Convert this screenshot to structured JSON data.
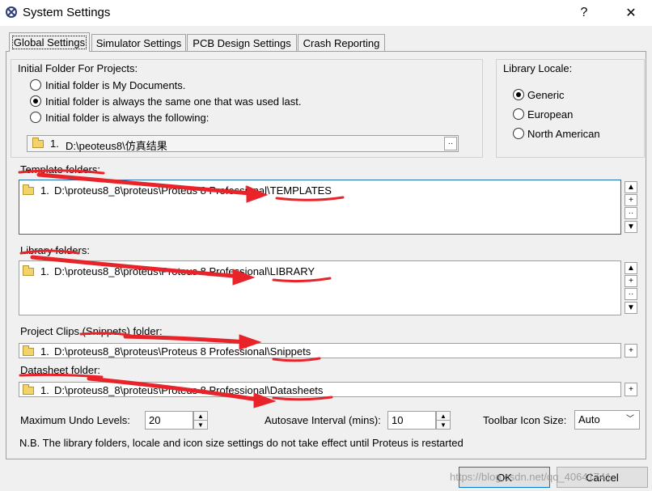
{
  "window": {
    "title": "System Settings",
    "help_label": "?",
    "close_label": "✕"
  },
  "tabs": [
    {
      "label": "Global Settings",
      "active": true
    },
    {
      "label": "Simulator Settings",
      "active": false
    },
    {
      "label": "PCB Design Settings",
      "active": false
    },
    {
      "label": "Crash Reporting",
      "active": false
    }
  ],
  "initial_folder": {
    "heading": "Initial Folder For Projects:",
    "options": [
      {
        "label": "Initial folder is My Documents.",
        "selected": false
      },
      {
        "label": "Initial folder is always the same one that was used last.",
        "selected": true
      },
      {
        "label": "Initial folder is always the following:",
        "selected": false
      }
    ],
    "path_row": {
      "index": "1.",
      "path": "D:\\peoteus8\\仿真结果"
    },
    "browse_label": "··"
  },
  "library_locale": {
    "heading": "Library Locale:",
    "options": [
      {
        "label": "Generic",
        "selected": true
      },
      {
        "label": "European",
        "selected": false
      },
      {
        "label": "North American",
        "selected": false
      }
    ]
  },
  "template_folders": {
    "heading": "Template folders:",
    "rows": [
      {
        "index": "1.",
        "path": "D:\\proteus8_8\\proteus\\Proteus 8 Professional\\TEMPLATES"
      }
    ]
  },
  "library_folders": {
    "heading": "Library folders:",
    "rows": [
      {
        "index": "1.",
        "path": "D:\\proteus8_8\\proteus\\Proteus 8 Professional\\LIBRARY"
      }
    ]
  },
  "project_clips": {
    "heading": "Project Clips (Snippets) folder:",
    "row": {
      "index": "1.",
      "path": "D:\\proteus8_8\\proteus\\Proteus 8 Professional\\Snippets"
    }
  },
  "datasheet_folder": {
    "heading": "Datasheet folder:",
    "row": {
      "index": "1.",
      "path": "D:\\proteus8_8\\proteus\\Proteus 8 Professional\\Datasheets"
    }
  },
  "list_buttons": {
    "up": "▲",
    "add": "+",
    "browse": "··",
    "down": "▼"
  },
  "settings": {
    "undo_label": "Maximum Undo Levels:",
    "undo_value": "20",
    "autosave_label": "Autosave Interval (mins):",
    "autosave_value": "10",
    "toolbar_label": "Toolbar Icon Size:",
    "toolbar_value": "Auto"
  },
  "note": "N.B. The library folders, locale and icon size settings do not take effect until Proteus is restarted",
  "footer": {
    "ok_label": "OK",
    "cancel_label": "Cancel",
    "watermark": "https://blog.csdn.net/qq_40641741"
  },
  "colors": {
    "annotation": "#e8242a",
    "focus": "#1f6fb5"
  }
}
